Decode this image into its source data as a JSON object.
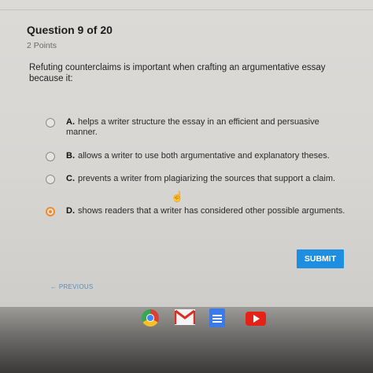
{
  "quiz": {
    "question_header": "Question 9 of 20",
    "points": "2 Points",
    "prompt": "Refuting counterclaims is important when crafting an argumentative essay because it:",
    "options": [
      {
        "letter": "A.",
        "text": "helps a writer structure the essay in an efficient and persuasive manner.",
        "selected": false
      },
      {
        "letter": "B.",
        "text": "allows a writer to use both argumentative and explanatory theses.",
        "selected": false
      },
      {
        "letter": "C.",
        "text": "prevents a writer from plagiarizing the sources that support a claim.",
        "selected": false
      },
      {
        "letter": "D.",
        "text": "shows readers that a writer has considered other possible arguments.",
        "selected": true
      }
    ],
    "submit_label": "SUBMIT",
    "previous_label": "← PREVIOUS"
  },
  "cursor_glyph": "☝",
  "colors": {
    "accent": "#1e8fe0",
    "selected_radio": "#f08a2a",
    "link": "#4a90cc"
  },
  "dock": {
    "icons": [
      "chrome-icon",
      "gmail-icon",
      "docs-icon",
      "youtube-icon"
    ]
  }
}
